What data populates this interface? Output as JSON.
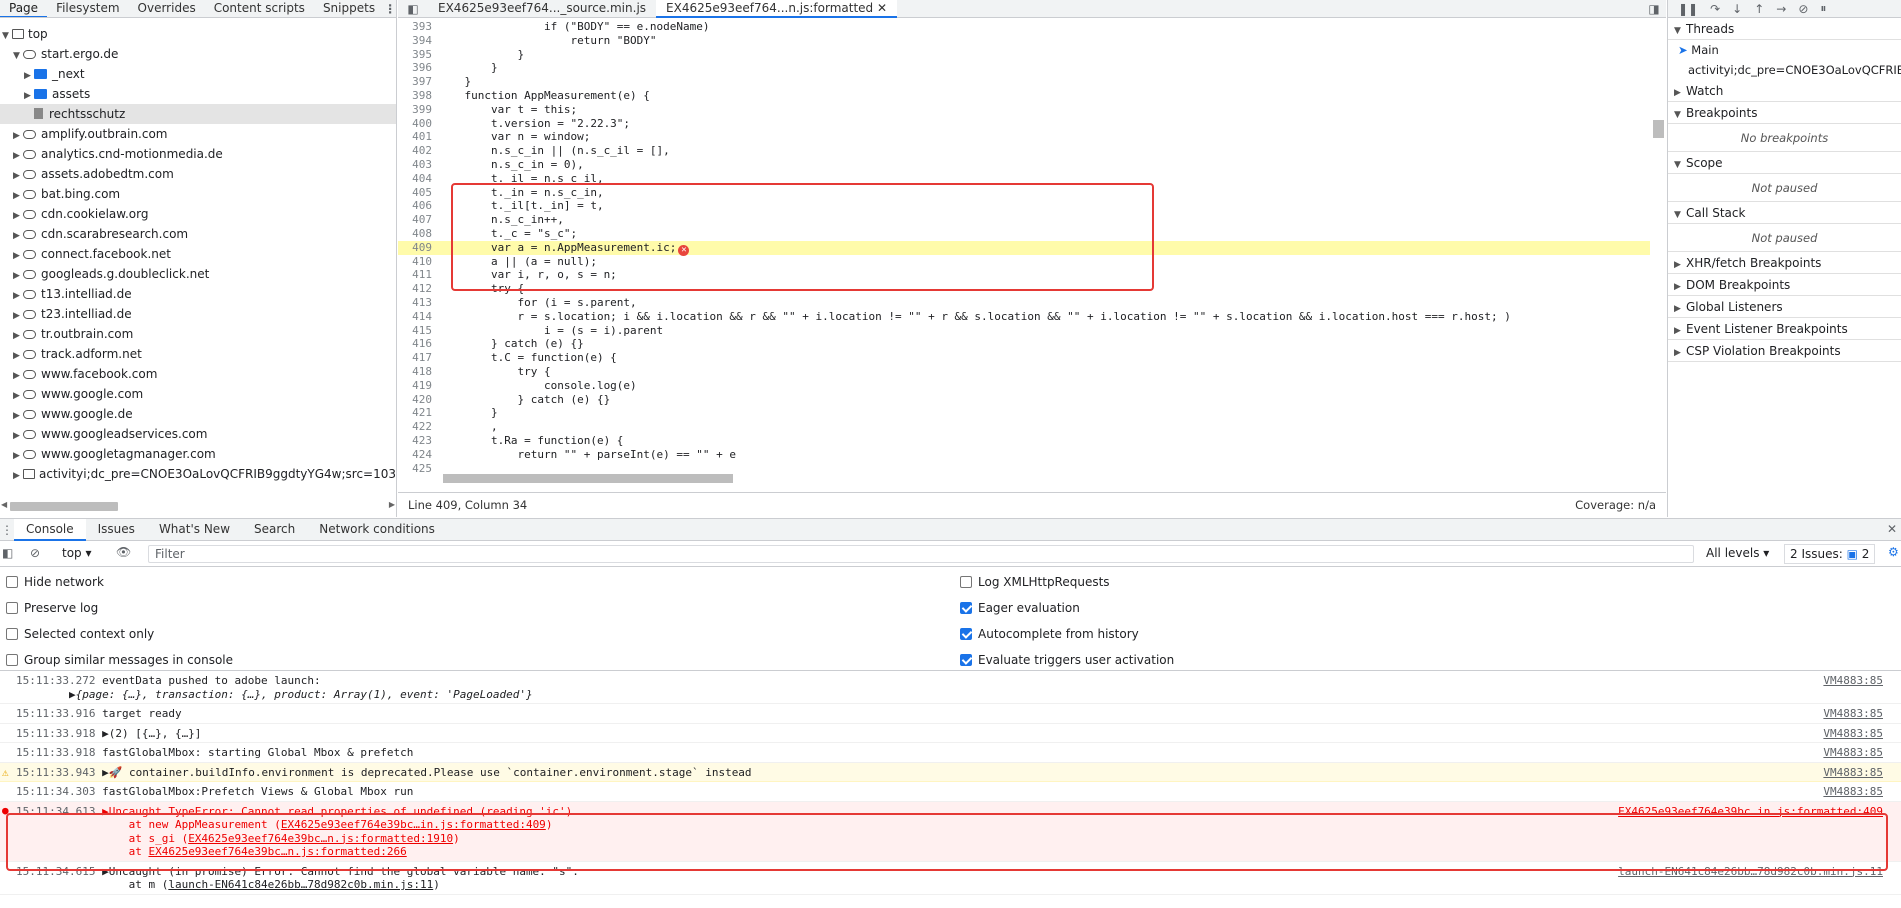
{
  "left_panel": {
    "tabs": [
      "Page",
      "Filesystem",
      "Overrides",
      "Content scripts",
      "Snippets"
    ],
    "menu_glyph": "⋮",
    "tree": [
      {
        "label": "top",
        "icon": "frame-icon",
        "depth": 0,
        "expanded": true
      },
      {
        "label": "start.ergo.de",
        "icon": "cloud-icon",
        "depth": 1,
        "expanded": true
      },
      {
        "label": "_next",
        "icon": "folder-icon",
        "depth": 2,
        "expanded": false
      },
      {
        "label": "assets",
        "icon": "folder-icon",
        "depth": 2,
        "expanded": false
      },
      {
        "label": "rechtsschutz",
        "icon": "file-icon",
        "depth": 2,
        "selected": true
      },
      {
        "label": "amplify.outbrain.com",
        "icon": "cloud-icon",
        "depth": 1
      },
      {
        "label": "analytics.cnd-motionmedia.de",
        "icon": "cloud-icon",
        "depth": 1
      },
      {
        "label": "assets.adobedtm.com",
        "icon": "cloud-icon",
        "depth": 1
      },
      {
        "label": "bat.bing.com",
        "icon": "cloud-icon",
        "depth": 1
      },
      {
        "label": "cdn.cookielaw.org",
        "icon": "cloud-icon",
        "depth": 1
      },
      {
        "label": "cdn.scarabresearch.com",
        "icon": "cloud-icon",
        "depth": 1
      },
      {
        "label": "connect.facebook.net",
        "icon": "cloud-icon",
        "depth": 1
      },
      {
        "label": "googleads.g.doubleclick.net",
        "icon": "cloud-icon",
        "depth": 1
      },
      {
        "label": "t13.intelliad.de",
        "icon": "cloud-icon",
        "depth": 1
      },
      {
        "label": "t23.intelliad.de",
        "icon": "cloud-icon",
        "depth": 1
      },
      {
        "label": "tr.outbrain.com",
        "icon": "cloud-icon",
        "depth": 1
      },
      {
        "label": "track.adform.net",
        "icon": "cloud-icon",
        "depth": 1
      },
      {
        "label": "www.facebook.com",
        "icon": "cloud-icon",
        "depth": 1
      },
      {
        "label": "www.google.com",
        "icon": "cloud-icon",
        "depth": 1
      },
      {
        "label": "www.google.de",
        "icon": "cloud-icon",
        "depth": 1
      },
      {
        "label": "www.googleadservices.com",
        "icon": "cloud-icon",
        "depth": 1
      },
      {
        "label": "www.googletagmanager.com",
        "icon": "cloud-icon",
        "depth": 1
      },
      {
        "label": "activityi;dc_pre=CNOE3OaLovQCFRIB9ggdtyYG4w;src=10334510;ty",
        "icon": "frame-icon",
        "depth": 1
      }
    ]
  },
  "editor": {
    "tabs": [
      {
        "label": "EX4625e93eef764..._source.min.js",
        "active": false
      },
      {
        "label": "EX4625e93eef764...n.js:formatted",
        "active": true
      }
    ],
    "close_glyph": "✕",
    "highlighted_line": 409,
    "lines": [
      {
        "n": "393",
        "t": "                if (\"BODY\" == e.nodeName)"
      },
      {
        "n": "394",
        "t": "                    return \"BODY\""
      },
      {
        "n": "395",
        "t": "            }"
      },
      {
        "n": "396",
        "t": "        }"
      },
      {
        "n": "397",
        "t": "    }"
      },
      {
        "n": "398",
        "t": "    function AppMeasurement(e) {"
      },
      {
        "n": "399",
        "t": "        var t = this;"
      },
      {
        "n": "400",
        "t": "        t.version = \"2.22.3\";"
      },
      {
        "n": "401",
        "t": "        var n = window;"
      },
      {
        "n": "402",
        "t": "        n.s_c_in || (n.s_c_il = [],"
      },
      {
        "n": "403",
        "t": "        n.s_c_in = 0),"
      },
      {
        "n": "404",
        "t": "        t._il = n.s_c_il,"
      },
      {
        "n": "405",
        "t": "        t._in = n.s_c_in,"
      },
      {
        "n": "406",
        "t": "        t._il[t._in] = t,"
      },
      {
        "n": "407",
        "t": "        n.s_c_in++,"
      },
      {
        "n": "408",
        "t": "        t._c = \"s_c\";"
      },
      {
        "n": "409",
        "t": "        var a = n.AppMeasurement.ic;"
      },
      {
        "n": "410",
        "t": "        a || (a = null);"
      },
      {
        "n": "411",
        "t": "        var i, r, o, s = n;"
      },
      {
        "n": "412",
        "t": "        try {"
      },
      {
        "n": "413",
        "t": "            for (i = s.parent,"
      },
      {
        "n": "414",
        "t": "            r = s.location; i && i.location && r && \"\" + i.location != \"\" + r && s.location && \"\" + i.location != \"\" + s.location && i.location.host === r.host; )"
      },
      {
        "n": "415",
        "t": "                i = (s = i).parent"
      },
      {
        "n": "416",
        "t": "        } catch (e) {}"
      },
      {
        "n": "417",
        "t": "        t.C = function(e) {"
      },
      {
        "n": "418",
        "t": "            try {"
      },
      {
        "n": "419",
        "t": "                console.log(e)"
      },
      {
        "n": "420",
        "t": "            } catch (e) {}"
      },
      {
        "n": "421",
        "t": "        }"
      },
      {
        "n": "422",
        "t": "        ,"
      },
      {
        "n": "423",
        "t": "        t.Ra = function(e) {"
      },
      {
        "n": "424",
        "t": "            return \"\" + parseInt(e) == \"\" + e"
      },
      {
        "n": "425",
        "t": ""
      }
    ],
    "status_left": "Line 409, Column 34",
    "status_right": "Coverage: n/a"
  },
  "debugger": {
    "sections": [
      {
        "label": "Threads",
        "expanded": true
      },
      {
        "label": "Watch",
        "expanded": false
      },
      {
        "label": "Breakpoints",
        "expanded": true,
        "body": "No breakpoints"
      },
      {
        "label": "Scope",
        "expanded": true,
        "body": "Not paused"
      },
      {
        "label": "Call Stack",
        "expanded": true,
        "body": "Not paused"
      },
      {
        "label": "XHR/fetch Breakpoints",
        "expanded": false
      },
      {
        "label": "DOM Breakpoints",
        "expanded": false
      },
      {
        "label": "Global Listeners",
        "expanded": false
      },
      {
        "label": "Event Listener Breakpoints",
        "expanded": false
      },
      {
        "label": "CSP Violation Breakpoints",
        "expanded": false
      }
    ],
    "threads": [
      "Main",
      "activityi;dc_pre=CNOE3OaLovQCFRIB9..."
    ]
  },
  "drawer": {
    "tabs": [
      "Console",
      "Issues",
      "What's New",
      "Search",
      "Network conditions"
    ],
    "close_glyph": "✕",
    "context": "top",
    "filter_placeholder": "Filter",
    "levels": "All levels",
    "issues": "2 Issues:",
    "issues_count": "2",
    "settings_left": [
      {
        "label": "Hide network",
        "checked": false
      },
      {
        "label": "Preserve log",
        "checked": false
      },
      {
        "label": "Selected context only",
        "checked": false
      },
      {
        "label": "Group similar messages in console",
        "checked": false
      }
    ],
    "settings_right": [
      {
        "label": "Log XMLHttpRequests",
        "checked": false
      },
      {
        "label": "Eager evaluation",
        "checked": true
      },
      {
        "label": "Autocomplete from history",
        "checked": true
      },
      {
        "label": "Evaluate triggers user activation",
        "checked": true
      }
    ]
  },
  "console": {
    "messages": [
      {
        "type": "log",
        "time": "15:11:33.272",
        "text": "eventData pushed to adobe launch:",
        "sub": "▶{page: {…}, transaction: {…}, product: Array(1), event: 'PageLoaded'}",
        "src": "VM4883:85"
      },
      {
        "type": "log",
        "time": "15:11:33.916",
        "text": "target ready",
        "src": "VM4883:85"
      },
      {
        "type": "log",
        "time": "15:11:33.918",
        "text": "▶(2) [{…}, {…}]",
        "src": "VM4883:85"
      },
      {
        "type": "log",
        "time": "15:11:33.918",
        "text": "fastGlobalMbox: starting Global Mbox & prefetch",
        "src": "VM4883:85"
      },
      {
        "type": "warn",
        "time": "15:11:33.943",
        "text": "▶🚀 container.buildInfo.environment is deprecated.Please use `container.environment.stage` instead",
        "src": "VM4883:85"
      },
      {
        "type": "log",
        "time": "15:11:34.303",
        "text": "fastGlobalMbox:Prefetch Views & Global Mbox run",
        "src": "VM4883:85"
      },
      {
        "type": "error",
        "time": "15:11:34.613",
        "text": "▶Uncaught TypeError: Cannot read properties of undefined (reading 'ic')",
        "stack": [
          {
            "pre": "    at new AppMeasurement (",
            "link": "EX4625e93eef764e39bc…in.js:formatted:409",
            "post": ")"
          },
          {
            "pre": "    at s_gi (",
            "link": "EX4625e93eef764e39bc…n.js:formatted:1910",
            "post": ")"
          },
          {
            "pre": "    at ",
            "link": "EX4625e93eef764e39bc…n.js:formatted:266",
            "post": ""
          }
        ],
        "src": "EX4625e93eef764e39bc…in.js:formatted:409"
      },
      {
        "type": "log",
        "time": "15:11:34.615",
        "text": "▶Uncaught (in promise) Error: Cannot find the global variable name: \"s\".",
        "stack": [
          {
            "pre": "    at m (",
            "link": "launch-EN641c84e26bb…78d982c0b.min.js:11",
            "post": ")"
          }
        ],
        "src": "launch-EN641c84e26bb…78d982c0b.min.js:11"
      }
    ]
  },
  "colors": {
    "accent": "#1a73e8",
    "highlight": "#fffbaa",
    "error": "#e53935",
    "warn_bg": "#fffbe5"
  }
}
